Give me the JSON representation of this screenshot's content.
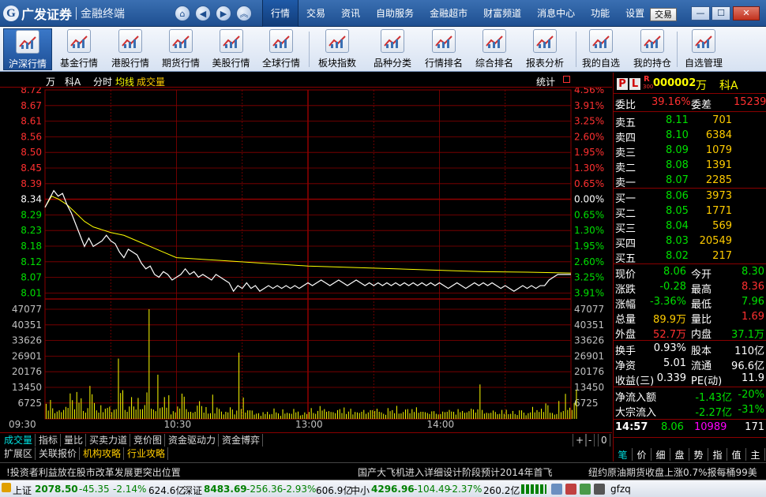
{
  "app": {
    "logo_text": "广发证券",
    "logo_sub": "金融终端",
    "logo_mark": "G",
    "nav": {
      "home": "⌂",
      "back": "◀",
      "forward": "▶",
      "up": "︽"
    },
    "menu": [
      "行情",
      "交易",
      "资讯",
      "自助服务",
      "金融超市",
      "财富频道",
      "消息中心",
      "功能",
      "设置"
    ],
    "trade_button": "交易",
    "window": {
      "min": "—",
      "max": "☐",
      "close": "✕"
    }
  },
  "toolbar": [
    {
      "label": "沪深行情",
      "icon": "kline-icon",
      "active": true
    },
    {
      "label": "基金行情",
      "icon": "fund-chart-icon"
    },
    {
      "label": "港股行情",
      "icon": "hk-chart-icon"
    },
    {
      "label": "期货行情",
      "icon": "futures-chart-icon"
    },
    {
      "label": "美股行情",
      "icon": "us-chart-icon"
    },
    {
      "label": "全球行情",
      "icon": "globe-icon"
    },
    {
      "label": "板块指数",
      "icon": "sector-index-icon"
    },
    {
      "label": "品种分类",
      "icon": "category-icon"
    },
    {
      "label": "行情排名",
      "icon": "ranking-icon"
    },
    {
      "label": "综合排名",
      "icon": "composite-rank-icon"
    },
    {
      "label": "报表分析",
      "icon": "report-icon"
    },
    {
      "label": "我的自选",
      "icon": "watchlist-icon"
    },
    {
      "label": "我的持仓",
      "icon": "holdings-icon"
    },
    {
      "label": "自选管理",
      "icon": "manage-icon"
    }
  ],
  "chart_header": {
    "name1": "万",
    "name2": "科A",
    "mode": "分时",
    "avg_label": "均线",
    "vol_label": "成交量",
    "stats": "统计"
  },
  "colors": {
    "up": "#ff3030",
    "down": "#00e000",
    "price_line": "#ffffff",
    "avg_line": "#ffff00",
    "grid": "#8a0000",
    "volume": "#ffff00",
    "label": "#c0c0c0",
    "gold": "#ffcc00",
    "magenta": "#ff00ff"
  },
  "chart_data": {
    "type": "line",
    "prev_close": 8.34,
    "price_ticks": [
      "8.72",
      "8.67",
      "8.61",
      "8.56",
      "8.50",
      "8.45",
      "8.39",
      "8.34",
      "8.29",
      "8.23",
      "8.18",
      "8.12",
      "8.07",
      "8.01"
    ],
    "pct_ticks": [
      "4.56%",
      "3.91%",
      "3.25%",
      "2.60%",
      "1.95%",
      "1.30%",
      "0.65%",
      "0.00%",
      "0.65%",
      "1.30%",
      "1.95%",
      "2.60%",
      "3.25%",
      "3.91%"
    ],
    "volume_ticks": [
      "47077",
      "40351",
      "33626",
      "26901",
      "20176",
      "13450",
      "6725"
    ],
    "time_labels": [
      "09:30",
      "10:30",
      "13:00",
      "14:00"
    ],
    "price_range": [
      7.975,
      8.72
    ],
    "volume_max": 53800,
    "minutes": 240,
    "price_series": {
      "name": "分时",
      "points": [
        [
          0,
          8.3
        ],
        [
          2,
          8.33
        ],
        [
          4,
          8.36
        ],
        [
          6,
          8.34
        ],
        [
          8,
          8.35
        ],
        [
          10,
          8.31
        ],
        [
          12,
          8.28
        ],
        [
          14,
          8.24
        ],
        [
          16,
          8.2
        ],
        [
          18,
          8.16
        ],
        [
          20,
          8.19
        ],
        [
          22,
          8.16
        ],
        [
          24,
          8.17
        ],
        [
          26,
          8.18
        ],
        [
          28,
          8.2
        ],
        [
          30,
          8.18
        ],
        [
          32,
          8.17
        ],
        [
          34,
          8.14
        ],
        [
          36,
          8.12
        ],
        [
          38,
          8.15
        ],
        [
          40,
          8.14
        ],
        [
          42,
          8.13
        ],
        [
          44,
          8.1
        ],
        [
          46,
          8.08
        ],
        [
          48,
          8.09
        ],
        [
          50,
          8.06
        ],
        [
          52,
          8.05
        ],
        [
          54,
          8.07
        ],
        [
          56,
          8.06
        ],
        [
          58,
          8.04
        ],
        [
          60,
          8.05
        ],
        [
          62,
          8.06
        ],
        [
          64,
          8.08
        ],
        [
          66,
          8.06
        ],
        [
          68,
          8.07
        ],
        [
          70,
          8.05
        ],
        [
          72,
          8.06
        ],
        [
          74,
          8.05
        ],
        [
          76,
          8.04
        ],
        [
          78,
          8.06
        ],
        [
          80,
          8.05
        ],
        [
          82,
          8.04
        ],
        [
          84,
          8.03
        ],
        [
          86,
          8.0
        ],
        [
          88,
          8.02
        ],
        [
          90,
          8.01
        ],
        [
          92,
          8.03
        ],
        [
          94,
          8.01
        ],
        [
          96,
          8.02
        ],
        [
          98,
          8.0
        ],
        [
          100,
          8.01
        ],
        [
          102,
          8.02
        ],
        [
          104,
          8.01
        ],
        [
          106,
          8.02
        ],
        [
          108,
          8.01
        ],
        [
          110,
          8.02
        ],
        [
          112,
          8.01
        ],
        [
          114,
          8.02
        ],
        [
          116,
          8.01
        ],
        [
          118,
          8.02
        ],
        [
          120,
          8.03
        ],
        [
          122,
          8.02
        ],
        [
          124,
          8.03
        ],
        [
          126,
          8.04
        ],
        [
          128,
          8.03
        ],
        [
          130,
          8.02
        ],
        [
          132,
          8.03
        ],
        [
          134,
          8.04
        ],
        [
          136,
          8.03
        ],
        [
          138,
          8.02
        ],
        [
          140,
          8.03
        ],
        [
          142,
          8.04
        ],
        [
          144,
          8.03
        ],
        [
          146,
          8.02
        ],
        [
          148,
          8.03
        ],
        [
          150,
          8.02
        ],
        [
          152,
          8.03
        ],
        [
          154,
          8.02
        ],
        [
          156,
          8.03
        ],
        [
          158,
          8.02
        ],
        [
          160,
          8.03
        ],
        [
          162,
          8.02
        ],
        [
          164,
          8.03
        ],
        [
          166,
          8.02
        ],
        [
          168,
          8.03
        ],
        [
          170,
          8.02
        ],
        [
          172,
          8.03
        ],
        [
          174,
          8.02
        ],
        [
          176,
          8.03
        ],
        [
          178,
          8.02
        ],
        [
          180,
          8.03
        ],
        [
          182,
          8.02
        ],
        [
          184,
          8.01
        ],
        [
          186,
          8.02
        ],
        [
          188,
          8.03
        ],
        [
          190,
          8.02
        ],
        [
          192,
          8.01
        ],
        [
          194,
          8.02
        ],
        [
          196,
          8.03
        ],
        [
          198,
          8.02
        ],
        [
          200,
          8.03
        ],
        [
          202,
          8.02
        ],
        [
          204,
          8.03
        ],
        [
          206,
          8.02
        ],
        [
          208,
          8.01
        ],
        [
          210,
          8.02
        ],
        [
          212,
          8.01
        ],
        [
          214,
          8.0
        ],
        [
          216,
          8.01
        ],
        [
          218,
          8.02
        ],
        [
          220,
          8.01
        ],
        [
          222,
          8.02
        ],
        [
          224,
          8.01
        ],
        [
          226,
          8.02
        ],
        [
          228,
          8.02
        ],
        [
          230,
          8.04
        ],
        [
          232,
          8.05
        ],
        [
          234,
          8.06
        ],
        [
          236,
          8.06
        ],
        [
          238,
          8.06
        ],
        [
          240,
          8.06
        ]
      ]
    },
    "avg_series": {
      "name": "均线",
      "points": [
        [
          0,
          8.3
        ],
        [
          3,
          8.34
        ],
        [
          6,
          8.33
        ],
        [
          10,
          8.31
        ],
        [
          14,
          8.28
        ],
        [
          18,
          8.25
        ],
        [
          22,
          8.23
        ],
        [
          26,
          8.22
        ],
        [
          30,
          8.21
        ],
        [
          36,
          8.2
        ],
        [
          42,
          8.18
        ],
        [
          48,
          8.16
        ],
        [
          54,
          8.14
        ],
        [
          60,
          8.12
        ],
        [
          70,
          8.115
        ],
        [
          80,
          8.11
        ],
        [
          100,
          8.1
        ],
        [
          120,
          8.09
        ],
        [
          140,
          8.085
        ],
        [
          160,
          8.08
        ],
        [
          180,
          8.075
        ],
        [
          200,
          8.07
        ],
        [
          220,
          8.068
        ],
        [
          240,
          8.065
        ]
      ]
    },
    "volume_bars": [
      7400,
      4100,
      9300,
      5200,
      2800,
      3600,
      4200,
      3300,
      4400,
      5900,
      5400,
      12500,
      9200,
      4700,
      13200,
      8000,
      10100,
      3900,
      3100,
      5300,
      16200,
      12100,
      7800,
      4200,
      3100,
      6700,
      3300,
      5000,
      5400,
      6000,
      3300,
      4500,
      4800,
      29600,
      12700,
      14100,
      4400,
      3500,
      6100,
      10700,
      6100,
      4600,
      10300,
      4700,
      4800,
      6800,
      13000,
      53800,
      5000,
      4600,
      3800,
      21700,
      5300,
      5700,
      10700,
      5500,
      11600,
      2200,
      3800,
      3200,
      6100,
      5100,
      12400,
      10900,
      4800,
      3400,
      3500,
      3000,
      3500,
      6500,
      8700,
      6300,
      3100,
      5800,
      2600,
      2800,
      11900,
      2700,
      5600,
      4900,
      3600,
      2200,
      3500,
      3200,
      5700,
      4600,
      2200,
      4100,
      32500,
      4900,
      10500,
      3100,
      4200,
      4200,
      4100,
      2100,
      2600,
      2800,
      1500,
      3300,
      2400,
      3500,
      2200,
      2400,
      5100,
      3200,
      2700,
      1500,
      4700,
      2600,
      3000,
      2700,
      2500,
      4900,
      3200,
      3600,
      1700,
      2000,
      3200,
      2400,
      3400,
      5300,
      2900,
      2500,
      3900,
      6300,
      4100,
      4800,
      3500,
      3800,
      3400,
      3300,
      2800,
      4300,
      4800,
      2900,
      5600,
      2400,
      3600,
      5000,
      2200,
      3400,
      3200,
      2900,
      3500,
      4400,
      2500,
      3200,
      4300,
      4300,
      3900,
      5000,
      3500,
      3200,
      2500,
      2000,
      5300,
      3800,
      4300,
      2800,
      6400,
      2600,
      2700,
      3400,
      4600,
      4800,
      2800,
      4800,
      3400,
      5700,
      3000,
      3500,
      3500,
      3300,
      2900,
      2400,
      3700,
      3800,
      2500,
      2200,
      2400,
      3600,
      3300,
      3500,
      4400,
      3600,
      3500,
      2100,
      4800,
      3300,
      3900,
      3000,
      3200,
      3800,
      5000,
      4600,
      3100,
      4700,
      16900,
      4400,
      2600,
      3000,
      2800,
      3000,
      4100,
      3400,
      2300,
      2500,
      4400,
      2500,
      4500,
      2300,
      2500,
      3900,
      2400,
      1900,
      4200,
      4200,
      3100,
      1800,
      2800,
      3200,
      5900,
      3200,
      4300,
      3400,
      5000,
      3400,
      7600,
      6700,
      3000,
      2900,
      2100,
      2400,
      8800,
      3300,
      3900,
      12300,
      4400,
      5500,
      4400,
      7900,
      14300
    ]
  },
  "bottom_tabs": {
    "row1": [
      "成交量",
      "指标",
      "量比",
      "买卖力道",
      "竞价图",
      "资金驱动力",
      "资金博弈"
    ],
    "row1_right": [
      "+",
      "-",
      "0"
    ],
    "row2": [
      "扩展区",
      "关联报价",
      "机构攻略",
      "行业攻略"
    ]
  },
  "quote": {
    "pl": [
      "P",
      "L"
    ],
    "r_badge": "R",
    "r_sub": "300",
    "code": "000002",
    "name1": "万",
    "name2": "科A",
    "weibi_label": "委比",
    "weibi": "39.16%",
    "weicha_label": "委差",
    "weicha": "15239",
    "sell": [
      {
        "label": "卖五",
        "price": "8.11",
        "vol": "701"
      },
      {
        "label": "卖四",
        "price": "8.10",
        "vol": "6384"
      },
      {
        "label": "卖三",
        "price": "8.09",
        "vol": "1079"
      },
      {
        "label": "卖二",
        "price": "8.08",
        "vol": "1391"
      },
      {
        "label": "卖一",
        "price": "8.07",
        "vol": "2285"
      }
    ],
    "buy": [
      {
        "label": "买一",
        "price": "8.06",
        "vol": "3973"
      },
      {
        "label": "买二",
        "price": "8.05",
        "vol": "1771"
      },
      {
        "label": "买三",
        "price": "8.04",
        "vol": "569"
      },
      {
        "label": "买四",
        "price": "8.03",
        "vol": "20549"
      },
      {
        "label": "买五",
        "price": "8.02",
        "vol": "217"
      }
    ],
    "stats": [
      {
        "l1": "现价",
        "v1": "8.06",
        "c1": "down",
        "l2": "今开",
        "v2": "8.30",
        "c2": "down"
      },
      {
        "l1": "涨跌",
        "v1": "-0.28",
        "c1": "down",
        "l2": "最高",
        "v2": "8.36",
        "c2": "up"
      },
      {
        "l1": "涨幅",
        "v1": "-3.36%",
        "c1": "down",
        "l2": "最低",
        "v2": "7.96",
        "c2": "down"
      },
      {
        "l1": "总量",
        "v1": "89.9万",
        "c1": "gold",
        "l2": "量比",
        "v2": "1.69",
        "c2": "up"
      },
      {
        "l1": "外盘",
        "v1": "52.7万",
        "c1": "up",
        "l2": "内盘",
        "v2": "37.1万",
        "c2": "down"
      }
    ],
    "stats2": [
      {
        "l1": "换手",
        "v1": "0.93%",
        "l2": "股本",
        "v2": "110亿"
      },
      {
        "l1": "净资",
        "v1": "5.01",
        "l2": "流通",
        "v2": "96.6亿"
      },
      {
        "l1": "收益(三)",
        "v1": "0.339",
        "l2": "PE(动)",
        "v2": "11.9"
      }
    ],
    "flows": [
      {
        "label": "净流入额",
        "v1": "-1.43亿",
        "v2": "-20%"
      },
      {
        "label": "大宗流入",
        "v1": "-2.27亿",
        "v2": "-31%"
      }
    ],
    "tick": {
      "time": "14:57",
      "price": "8.06",
      "vol": "10989",
      "count": "171"
    },
    "tabs": [
      "笔",
      "价",
      "细",
      "盘",
      "势",
      "指",
      "值",
      "主"
    ]
  },
  "news": {
    "left": "!投资者利益放在股市改革发展更突出位置",
    "mid": "国产大飞机进入详细设计阶段预计2014年首飞",
    "right": "纽约原油期货收盘上涨0.7%报每桶99美元"
  },
  "indexbar": {
    "sh_label": "上证",
    "sh_val": "2078.50",
    "sh_chg": "-45.35",
    "sh_pct": "-2.14%",
    "sh_amt": "624.6亿",
    "sz_label": "深证",
    "sz_val": "8483.69",
    "sz_chg": "-256.36",
    "sz_pct": "-2.93%",
    "sz_amt": "606.9亿",
    "zx_label": "中小",
    "zx_val": "4296.96",
    "zx_chg": "-104.49",
    "zx_pct": "-2.37%",
    "zx_amt": "260.2亿",
    "user": "gfzq"
  }
}
